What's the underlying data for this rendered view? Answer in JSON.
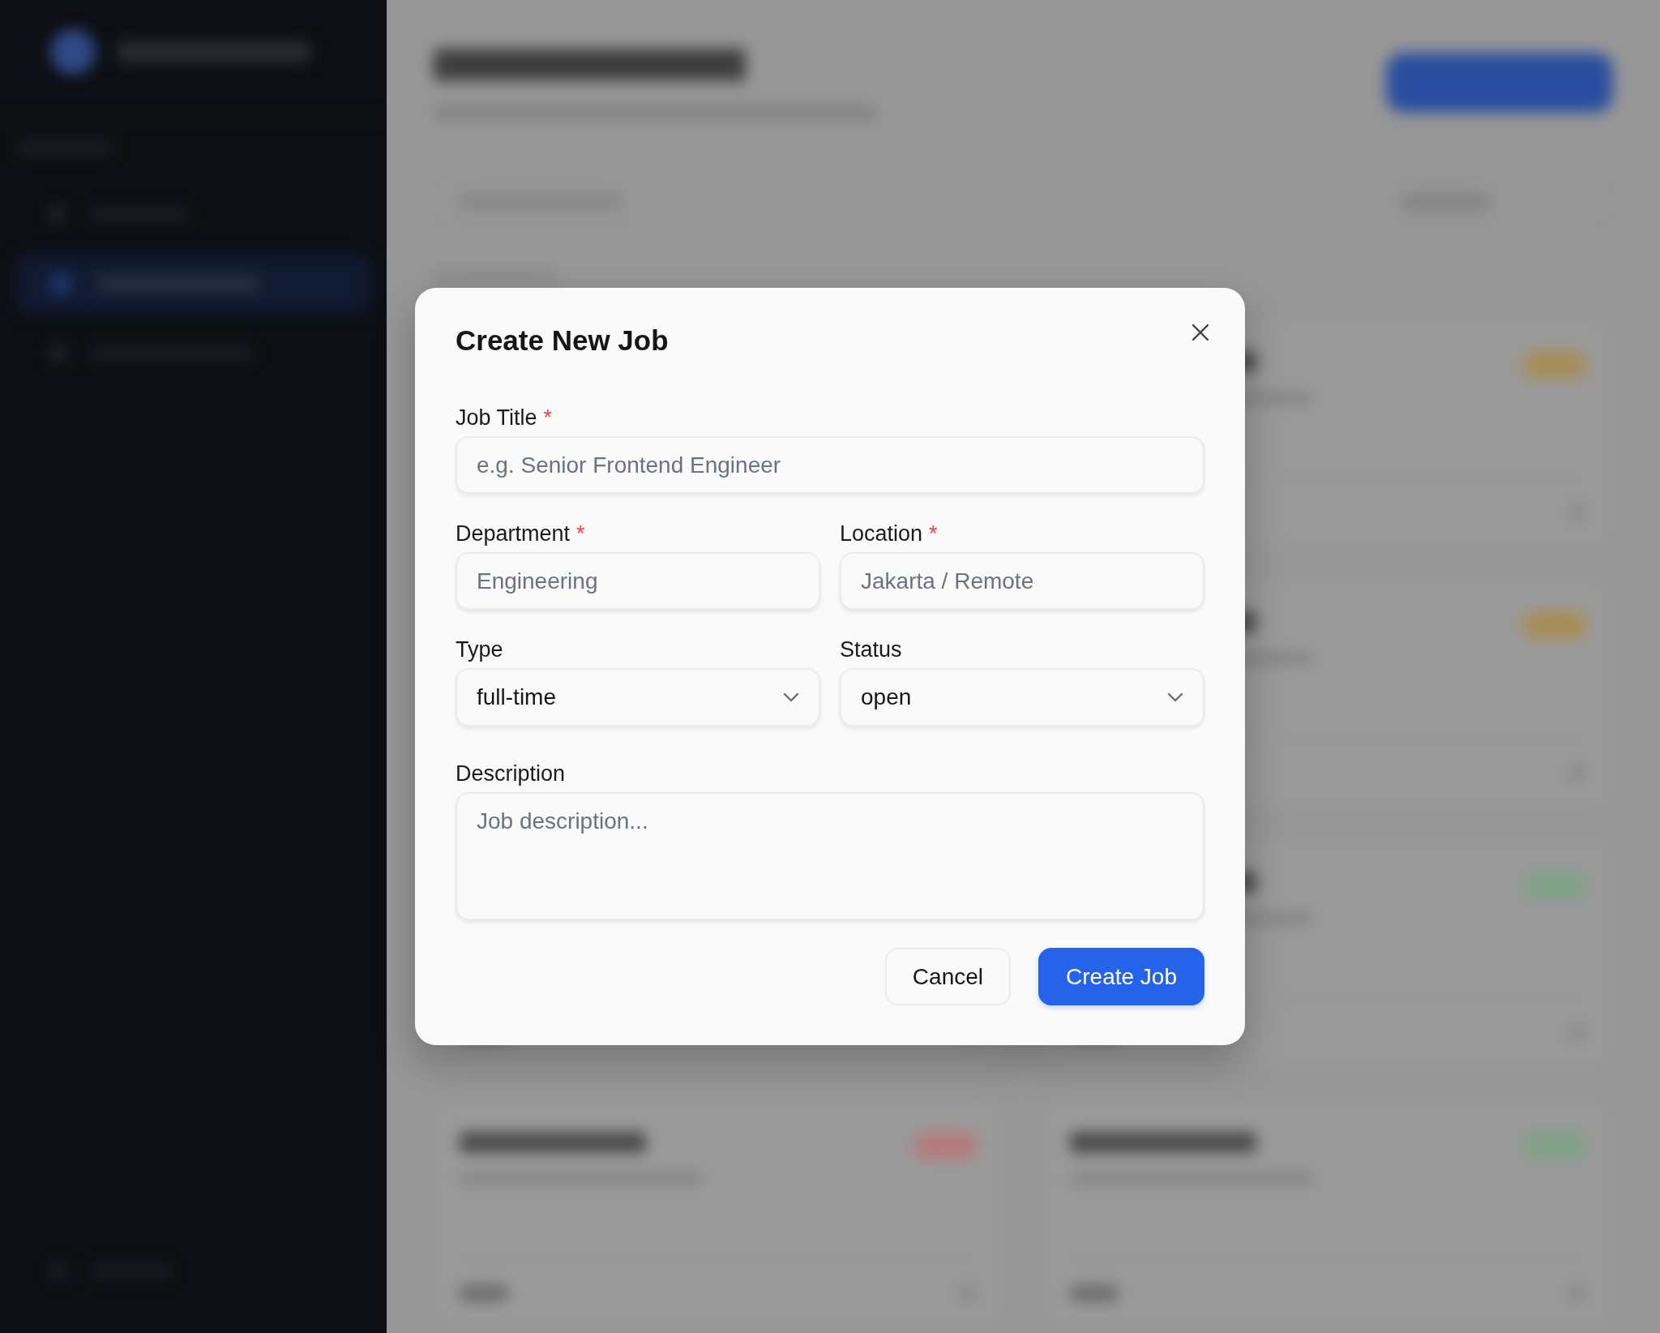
{
  "dialog": {
    "title": "Create New Job"
  },
  "form": {
    "rows": [
      {
        "fields": [
          {
            "kind": "text",
            "label": "Job Title",
            "required_mark": "*",
            "placeholder": "e.g. Senior Frontend Engineer"
          }
        ]
      },
      {
        "fields": [
          {
            "kind": "text",
            "label": "Department",
            "required_mark": "*",
            "placeholder": "Engineering"
          },
          {
            "kind": "text",
            "label": "Location",
            "required_mark": "*",
            "placeholder": "Jakarta / Remote"
          }
        ]
      },
      {
        "fields": [
          {
            "kind": "select",
            "label": "Type",
            "value": "full-time"
          },
          {
            "kind": "select",
            "label": "Status",
            "value": "open"
          }
        ]
      },
      {
        "fields": [
          {
            "kind": "textarea",
            "label": "Description",
            "placeholder": "Job description..."
          }
        ]
      }
    ]
  },
  "actions": [
    {
      "kind": "secondary",
      "label": "Cancel"
    },
    {
      "kind": "primary",
      "label": "Create Job"
    }
  ]
}
